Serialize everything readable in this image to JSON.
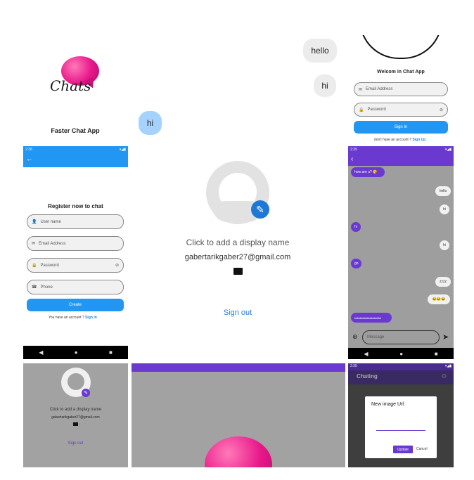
{
  "splash": {
    "logo_text": "Chats",
    "title": "Faster Chat App"
  },
  "bubbles": {
    "hello": "hello",
    "hi_right": "hi",
    "hi_blue": "hi"
  },
  "login": {
    "title": "Welcom in Chat App",
    "email_placeholder": "Email Address",
    "password_placeholder": "Password",
    "signin_button": "Sign In",
    "no_account_text": "don't have an account ?",
    "signup_link": "Sign Up"
  },
  "register": {
    "status_time": "2:38",
    "title": "Register now  to chat",
    "username_placeholder": "User name",
    "email_placeholder": "Email Address",
    "password_placeholder": "Password",
    "phone_placeholder": "Phone",
    "create_button": "Create",
    "have_account_text": "You have an account ?",
    "signin_link": "Sign in"
  },
  "profile": {
    "display_name_prompt": "Click to add a display name",
    "email": "gabertarikgaber27@gmail.com",
    "signout": "Sign out"
  },
  "chat": {
    "status_time": "2:39",
    "messages": [
      {
        "dir": "in",
        "text": "how are u? 😘"
      },
      {
        "dir": "out",
        "text": "hello"
      },
      {
        "dir": "out",
        "text": "hi"
      },
      {
        "dir": "in",
        "text": "hi"
      },
      {
        "dir": "out",
        "text": "hi"
      },
      {
        "dir": "in",
        "text": "go"
      },
      {
        "dir": "out",
        "text": "zzzz"
      },
      {
        "dir": "out",
        "text": "😂😂😂"
      },
      {
        "dir": "in",
        "text": "kkkkkkkkkkkkkkkkkkk"
      }
    ],
    "message_placeholder": "Message"
  },
  "profile_small": {
    "display_name_prompt": "Click to add a display name",
    "email": "gabertarikgaber27@gmail.com",
    "signout": "Sign out"
  },
  "dialog": {
    "status_time": "2:35",
    "app_title": "Chating",
    "title": "New image Url:",
    "update_button": "Update",
    "cancel_button": "Cancel"
  },
  "colors": {
    "blue": "#2196f3",
    "purple": "#6a3ad0",
    "pink": "#e8178a"
  }
}
